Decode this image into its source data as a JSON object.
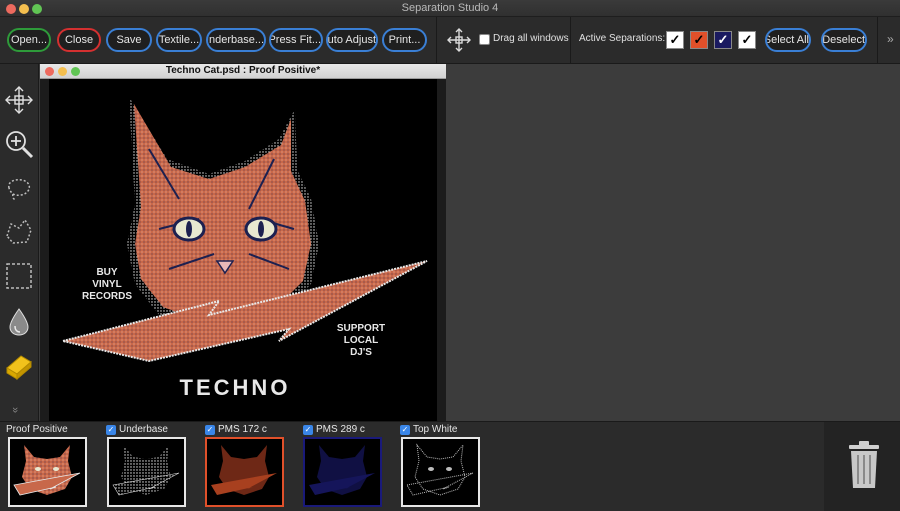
{
  "window": {
    "title": "Separation Studio 4"
  },
  "toolbar": {
    "buttons": [
      {
        "label": "Open...",
        "style": "green"
      },
      {
        "label": "Close",
        "style": "red"
      },
      {
        "label": "Save",
        "style": "blue"
      },
      {
        "label": "Textile...",
        "style": "blue"
      },
      {
        "label": "Underbase...",
        "style": "blue"
      },
      {
        "label": "Press Fit...",
        "style": "blue"
      },
      {
        "label": "Auto Adjust",
        "style": "blue"
      },
      {
        "label": "Print...",
        "style": "blue"
      }
    ],
    "drag_all_label": "Drag all windows",
    "drag_all_checked": false,
    "active_separations_label": "Active Separations:",
    "swatches": [
      {
        "color": "#ffffff",
        "checked": true
      },
      {
        "color": "#e0502a",
        "checked": true
      },
      {
        "color": "#1a1a60",
        "checked": true
      },
      {
        "color": "#ffffff",
        "checked": true
      }
    ],
    "select_all_label": "Select All",
    "deselect_label": "Deselect",
    "overflow_glyph": "»"
  },
  "tools": [
    {
      "name": "move-tool-icon"
    },
    {
      "name": "zoom-tool-icon"
    },
    {
      "name": "lasso-tool-icon"
    },
    {
      "name": "polygon-lasso-tool-icon"
    },
    {
      "name": "marquee-tool-icon"
    },
    {
      "name": "eyedropper-tool-icon"
    },
    {
      "name": "eraser-tool-icon"
    }
  ],
  "toolbox_more": "»",
  "document": {
    "title": "Techno Cat.psd : Proof Positive*",
    "artwork_text": {
      "left": [
        "BUY",
        "VINYL",
        "RECORDS"
      ],
      "right": [
        "SUPPORT",
        "LOCAL",
        "DJ'S"
      ],
      "bottom": "TECHNO"
    }
  },
  "separations": [
    {
      "label": "Proof Positive",
      "has_checkbox": false,
      "border": "#e8e8e8",
      "tint": "mixed"
    },
    {
      "label": "Underbase",
      "has_checkbox": true,
      "border": "#e8e8e8",
      "tint": "#d8d8d8"
    },
    {
      "label": "PMS 172 c",
      "has_checkbox": true,
      "border": "#e0502a",
      "tint": "#e0502a"
    },
    {
      "label": "PMS 289 c",
      "has_checkbox": true,
      "border": "#1a1a7a",
      "tint": "#23237a"
    },
    {
      "label": "Top White",
      "has_checkbox": true,
      "border": "#e8e8e8",
      "tint": "#bdbdbd"
    }
  ],
  "colors": {
    "accent_blue": "#3a7fd5",
    "open_green": "#2e9b3a",
    "close_red": "#d43030",
    "cat_orange": "#c8684a",
    "cat_navy": "#1c2050"
  }
}
